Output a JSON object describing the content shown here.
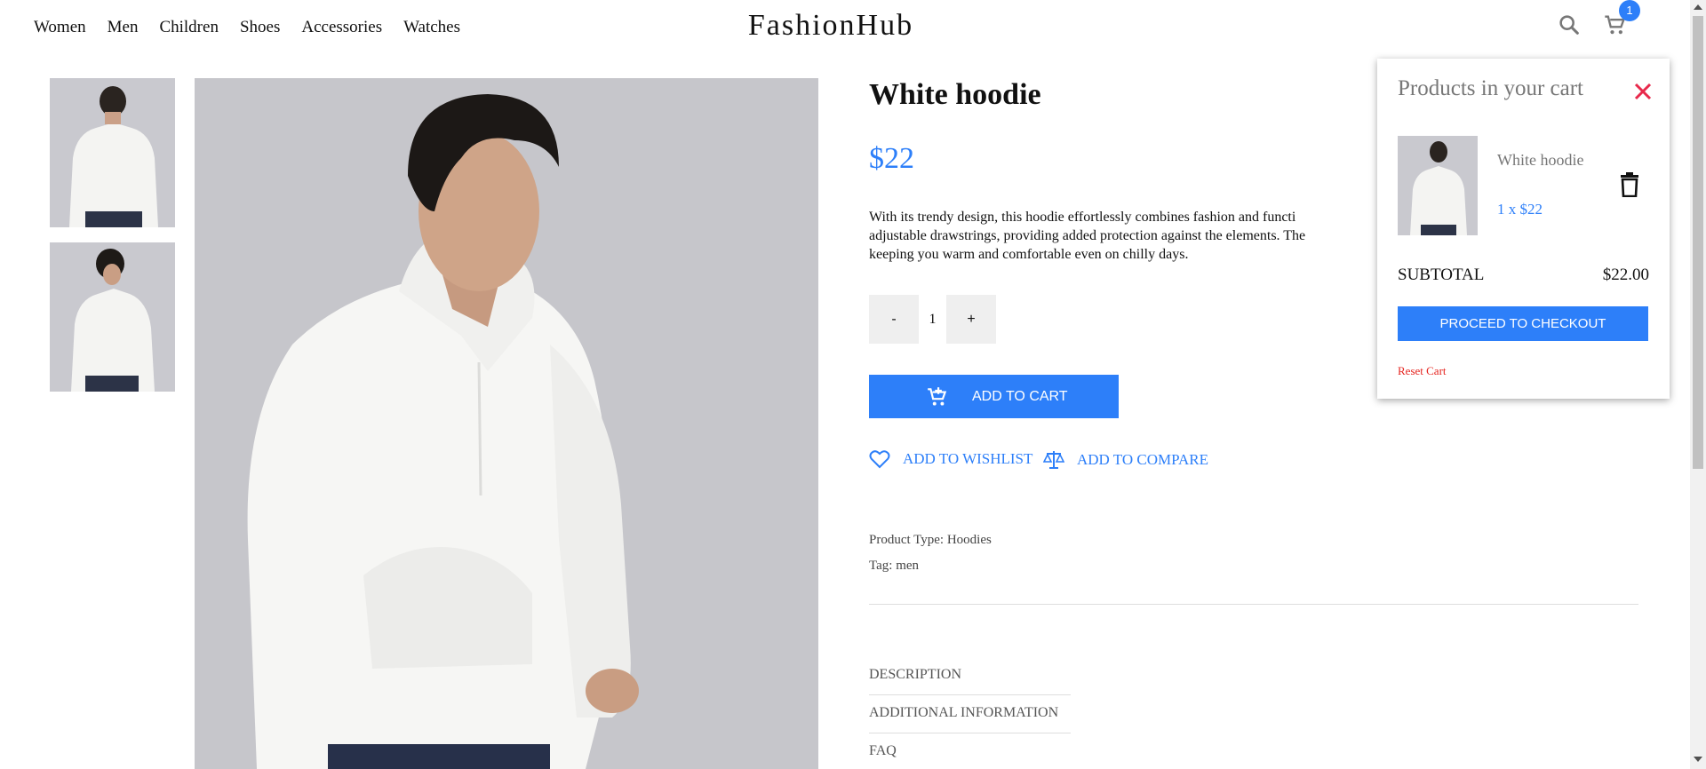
{
  "header": {
    "nav": [
      "Women",
      "Men",
      "Children",
      "Shoes",
      "Accessories",
      "Watches"
    ],
    "logo": "FashionHub",
    "cart_count": "1",
    "icons": [
      "search-icon",
      "cart-icon"
    ]
  },
  "product": {
    "title": "White hoodie",
    "price": "$22",
    "description": "With its trendy design, this hoodie effortlessly combines fashion and functi... adjustable drawstrings, providing added protection against the elements. The... keeping you warm and comfortable even on chilly days.",
    "description_lines": [
      "With its trendy design, this hoodie effortlessly combines fashion and functi",
      "adjustable drawstrings, providing added protection against the elements. The",
      "keeping you warm and comfortable even on chilly days."
    ],
    "quantity": {
      "minus": "-",
      "value": "1",
      "plus": "+"
    },
    "add_to_cart": "ADD TO CART",
    "add_to_wishlist": "ADD TO WISHLIST",
    "add_to_compare": "ADD TO COMPARE",
    "product_type": "Product Type: Hoodies",
    "tag": "Tag: men",
    "tabs": [
      "DESCRIPTION",
      "ADDITIONAL INFORMATION",
      "FAQ"
    ]
  },
  "cart_panel": {
    "title": "Products in your cart",
    "item_name": "White hoodie",
    "item_qty": "1 x $22",
    "subtotal_label": "SUBTOTAL",
    "subtotal_value": "$22.00",
    "checkout": "PROCEED TO CHECKOUT",
    "reset": "Reset Cart"
  },
  "colors": {
    "accent": "#2d7ff9",
    "close": "#e8294b",
    "reset": "#e5241f"
  }
}
